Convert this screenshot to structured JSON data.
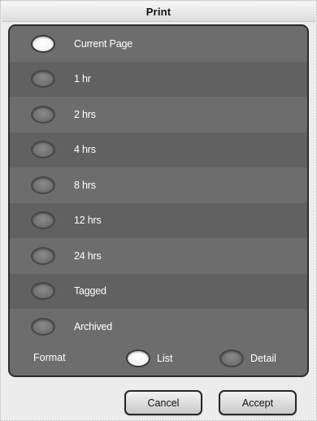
{
  "dialog": {
    "title": "Print"
  },
  "options": [
    {
      "label": "Current Page",
      "selected": true
    },
    {
      "label": "1 hr",
      "selected": false
    },
    {
      "label": "2 hrs",
      "selected": false
    },
    {
      "label": "4 hrs",
      "selected": false
    },
    {
      "label": "8 hrs",
      "selected": false
    },
    {
      "label": "12 hrs",
      "selected": false
    },
    {
      "label": "24 hrs",
      "selected": false
    },
    {
      "label": "Tagged",
      "selected": false
    },
    {
      "label": "Archived",
      "selected": false
    }
  ],
  "format": {
    "label": "Format",
    "options": [
      {
        "label": "List",
        "selected": true
      },
      {
        "label": "Detail",
        "selected": false
      }
    ]
  },
  "buttons": {
    "cancel": "Cancel",
    "accept": "Accept"
  },
  "colors": {
    "panel": "#6d6d6d",
    "panel_alt_row": "#616161",
    "selected_radio": "#ffffff"
  }
}
